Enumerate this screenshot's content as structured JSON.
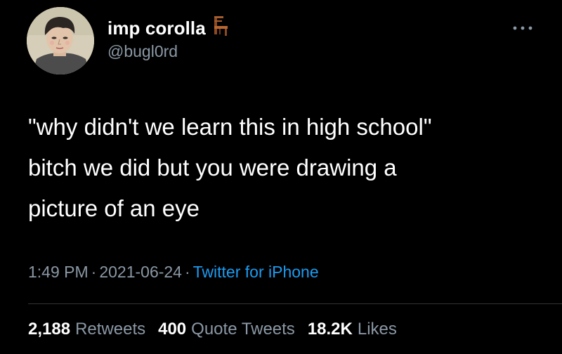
{
  "author": {
    "display_name": "imp corolla",
    "handle": "@bugl0rd",
    "name_emoji": "chair-icon",
    "avatar": "avatar-portrait-drawing"
  },
  "more_menu": {
    "icon": "more-horizontal-icon"
  },
  "tweet": {
    "text": "\"why didn't we learn this in high school\"\nbitch we did but you were drawing a\npicture of an eye",
    "time": "1:49 PM",
    "date": "2021-06-24",
    "separator": "·",
    "source": "Twitter for iPhone"
  },
  "stats": {
    "retweets_count": "2,188",
    "retweets_label": "Retweets",
    "quote_tweets_count": "400",
    "quote_tweets_label": "Quote Tweets",
    "likes_count": "18.2K",
    "likes_label": "Likes"
  },
  "colors": {
    "background": "#000000",
    "primary_text": "#ffffff",
    "secondary_text": "#8b98a5",
    "link": "#1d9bf0",
    "divider": "#2f3336"
  }
}
